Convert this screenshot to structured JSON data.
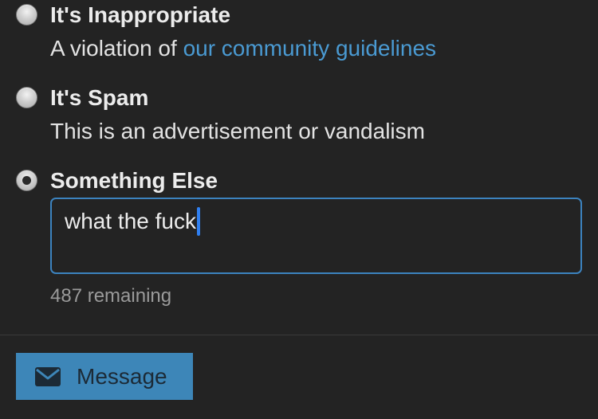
{
  "options": [
    {
      "title": "It's Inappropriate",
      "desc_prefix": "A violation of ",
      "desc_link": "our community guidelines",
      "checked": false
    },
    {
      "title": "It's Spam",
      "desc": "This is an advertisement or vandalism",
      "checked": false
    },
    {
      "title": "Something Else",
      "checked": true
    }
  ],
  "message_input": {
    "value": "what the fuck"
  },
  "remaining_text": "487 remaining",
  "submit": {
    "label": "Message",
    "icon": "envelope-icon"
  },
  "colors": {
    "background": "#232323",
    "link": "#4a9ad2",
    "input_border": "#3c83bf",
    "button_bg": "#3d86b8"
  }
}
